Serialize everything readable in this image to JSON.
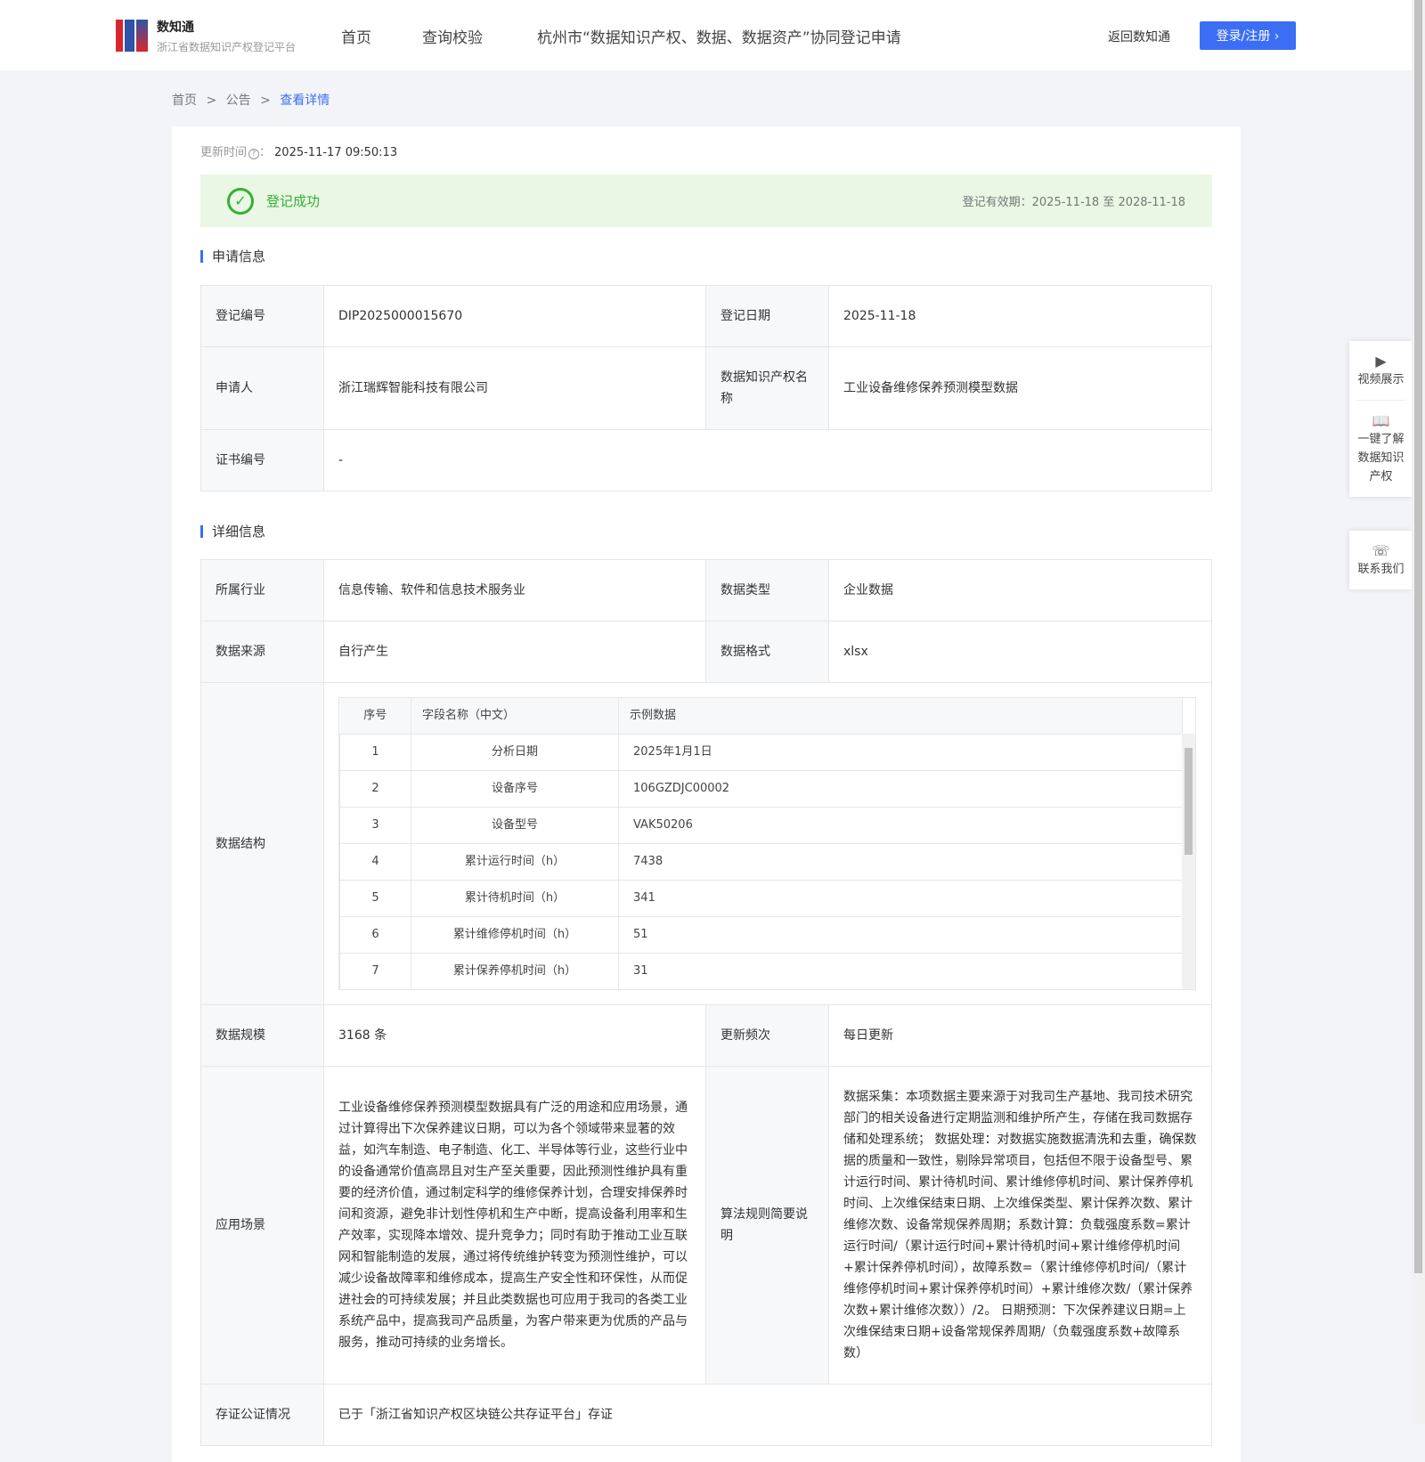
{
  "header": {
    "brand_title": "数知通",
    "brand_subtitle": "浙江省数据知识产权登记平台",
    "logo_text": "iIP",
    "nav": [
      "首页",
      "查询校验",
      "杭州市“数据知识产权、数据、数据资产”协同登记申请"
    ],
    "back": "返回数知通",
    "login": "登录/注册 ›"
  },
  "breadcrumb": {
    "home": "首页",
    "sep": ">",
    "notice": "公告",
    "current": "查看详情"
  },
  "update": {
    "label": "更新时间",
    "help_icon": "?",
    "colon": "：",
    "value": "2025-11-17 09:50:13"
  },
  "status": {
    "text": "登记成功",
    "validity": "登记有效期：2025-11-18 至 2028-11-18",
    "colors": {
      "success": "#35b032",
      "accent": "#3b6ef5"
    }
  },
  "apply": {
    "title": "申请信息",
    "reg_no_label": "登记编号",
    "reg_no": "DIP2025000015670",
    "reg_date_label": "登记日期",
    "reg_date": "2025-11-18",
    "applicant_label": "申请人",
    "applicant": "浙江瑞辉智能科技有限公司",
    "name_label": "数据知识产权名称",
    "name": "工业设备维修保养预测模型数据",
    "cert_label": "证书编号",
    "cert": "-"
  },
  "detail": {
    "title": "详细信息",
    "industry_label": "所属行业",
    "industry": "信息传输、软件和信息技术服务业",
    "type_label": "数据类型",
    "type": "企业数据",
    "source_label": "数据来源",
    "source": "自行产生",
    "format_label": "数据格式",
    "format": "xlsx",
    "structure_label": "数据结构",
    "structure": {
      "headers": [
        "序号",
        "字段名称（中文）",
        "示例数据"
      ],
      "rows": [
        [
          "1",
          "分析日期",
          "2025年1月1日"
        ],
        [
          "2",
          "设备序号",
          "106GZDJC00002"
        ],
        [
          "3",
          "设备型号",
          "VAK50206"
        ],
        [
          "4",
          "累计运行时间（h）",
          "7438"
        ],
        [
          "5",
          "累计待机时间（h）",
          "341"
        ],
        [
          "6",
          "累计维修停机时间（h）",
          "51"
        ],
        [
          "7",
          "累计保养停机时间（h）",
          "31"
        ]
      ]
    },
    "scale_label": "数据规模",
    "scale": "3168 条",
    "freq_label": "更新频次",
    "freq": "每日更新",
    "scenario_label": "应用场景",
    "scenario": "工业设备维修保养预测模型数据具有广泛的用途和应用场景，通过计算得出下次保养建议日期，可以为各个领域带来显著的效益，如汽车制造、电子制造、化工、半导体等行业，这些行业中的设备通常价值高昂且对生产至关重要，因此预测性维护具有重要的经济价值，通过制定科学的维修保养计划，合理安排保养时间和资源，避免非计划性停机和生产中断，提高设备利用率和生产效率，实现降本增效、提升竞争力；同时有助于推动工业互联网和智能制造的发展，通过将传统维护转变为预测性维护，可以减少设备故障率和维修成本，提高生产安全性和环保性，从而促进社会的可持续发展；并且此类数据也可应用于我司的各类工业系统产品中，提高我司产品质量，为客户带来更为优质的产品与服务，推动可持续的业务增长。",
    "algo_label": "算法规则简要说明",
    "algo": "数据采集：本项数据主要来源于对我司生产基地、我司技术研究部门的相关设备进行定期监测和维护所产生，存储在我司数据存储和处理系统； 数据处理：对数据实施数据清洗和去重，确保数据的质量和一致性，剔除异常项目，包括但不限于设备型号、累计运行时间、累计待机时间、累计维修停机时间、累计保养停机时间、上次维保结束日期、上次维保类型、累计保养次数、累计维修次数、设备常规保养周期；系数计算：负载强度系数=累计运行时间/（累计运行时间+累计待机时间+累计维修停机时间+累计保养停机时间），故障系数=（累计维修停机时间/（累计维修停机时间+累计保养停机时间）+累计维修次数/（累计保养次数+累计维修次数））/2。 日期预测：下次保养建议日期=上次维保结束日期+设备常规保养周期/（负载强度系数+故障系数）",
    "notary_label": "存证公证情况",
    "notary": "已于「浙江省知识产权区块链公共存证平台」存证"
  },
  "float": {
    "video": "视频展示",
    "learn": "一键了解数据知识产权",
    "contact": "联系我们"
  }
}
